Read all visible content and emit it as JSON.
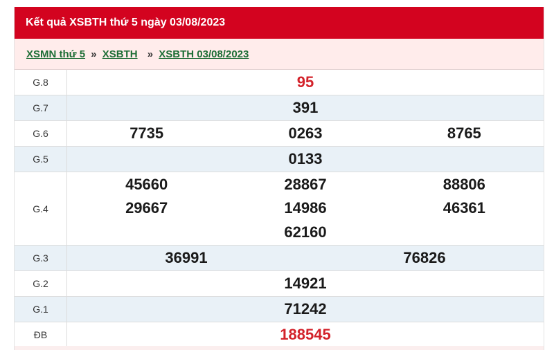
{
  "header": {
    "title": "Kết quả XSBTH thứ 5 ngày 03/08/2023"
  },
  "breadcrumb": {
    "items": [
      "XSMN thứ 5",
      "XSBTH",
      "XSBTH 03/08/2023"
    ],
    "separator": "»"
  },
  "prizes": [
    {
      "label": "G.8",
      "numbers": [
        "95"
      ]
    },
    {
      "label": "G.7",
      "numbers": [
        "391"
      ]
    },
    {
      "label": "G.6",
      "numbers": [
        "7735",
        "0263",
        "8765"
      ]
    },
    {
      "label": "G.5",
      "numbers": [
        "0133"
      ]
    },
    {
      "label": "G.4",
      "numbers": [
        "45660",
        "28867",
        "88806",
        "29667",
        "14986",
        "46361",
        "62160"
      ]
    },
    {
      "label": "G.3",
      "numbers": [
        "36991",
        "76826"
      ]
    },
    {
      "label": "G.2",
      "numbers": [
        "14921"
      ]
    },
    {
      "label": "G.1",
      "numbers": [
        "71242"
      ]
    },
    {
      "label": "ĐB",
      "numbers": [
        "188545"
      ]
    }
  ],
  "colors": {
    "header_bg": "#d3031f",
    "breadcrumb_bg": "#ffeceb",
    "link": "#1c6d35",
    "highlight_number": "#d3222a",
    "alt_row": "#e9f1f7"
  }
}
